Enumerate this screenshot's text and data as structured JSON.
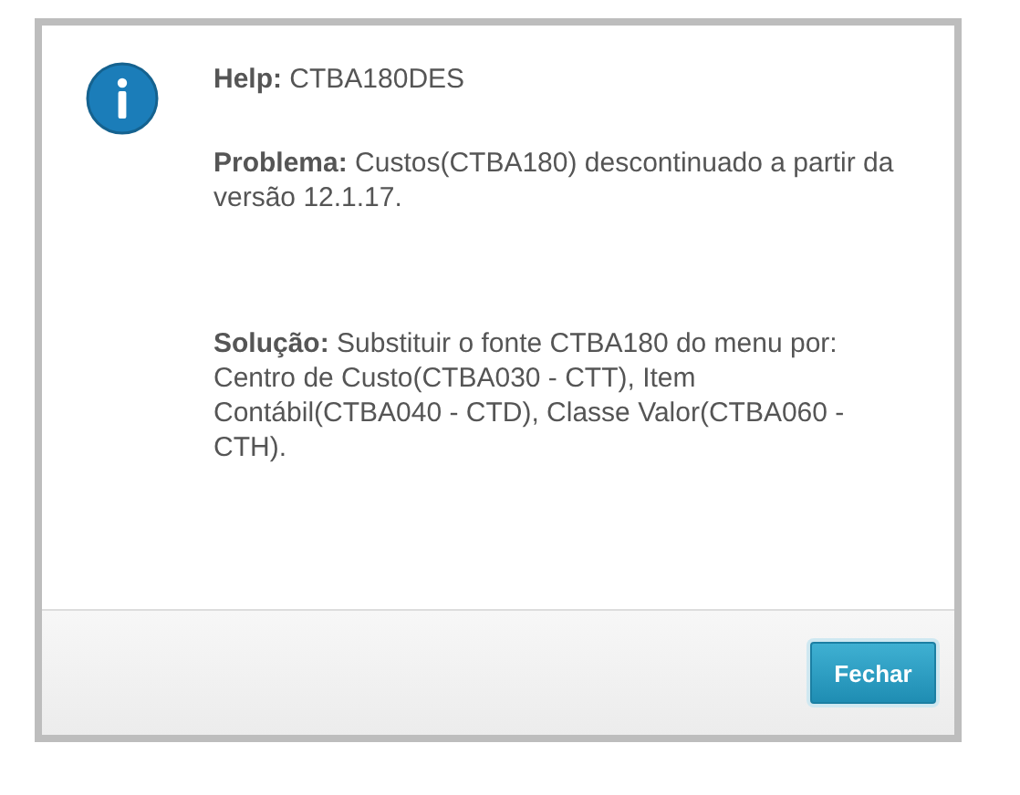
{
  "dialog": {
    "title_label": "Help:",
    "title_value": "CTBA180DES",
    "paragraphs": [
      {
        "label": "Problema:",
        "text": "Custos(CTBA180) descontinuado a partir da versão 12.1.17."
      },
      {
        "label": "Solução:",
        "text": "Substituir o fonte CTBA180 do menu por: Centro de Custo(CTBA030 - CTT), Item Contábil(CTBA040 - CTD), Classe Valor(CTBA060 - CTH)."
      }
    ]
  },
  "buttons": [
    "Fechar"
  ]
}
